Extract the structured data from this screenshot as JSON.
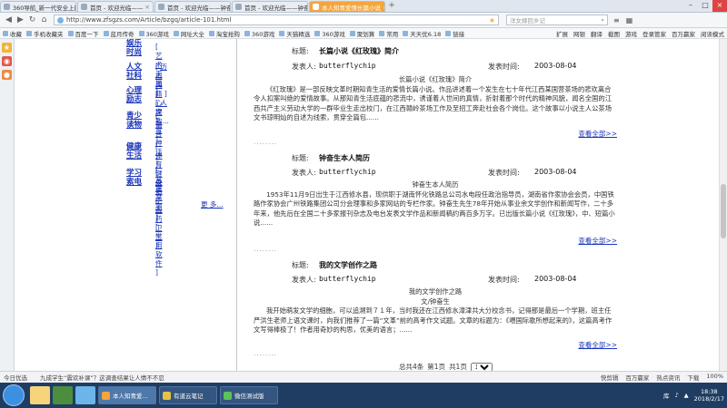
{
  "browser": {
    "tabs": [
      {
        "label": "360导航_新一代安全上网导航"
      },
      {
        "label": "首页 - 欢迎光临——"
      },
      {
        "label": "首页 - 欢迎光临——钟奋生工作"
      },
      {
        "label": "首页 - 欢迎光临——钟奋生工作"
      },
      {
        "label": "本人知青爱情长篇小说《红玫瑰》"
      }
    ],
    "url": "http://www.zfsgzs.com/Article/bzgq/article-101.html",
    "search_placeholder": "洋女嫁回乡记",
    "bookmarks": [
      "收藏",
      "手机收藏夹",
      "百度一下",
      "蓝月传奇",
      "360游戏",
      "网址大全",
      "淘宝抢购",
      "360游戏",
      "天猫精选",
      "360游戏",
      "聚划算",
      "常用",
      "天天优6.18",
      "链接"
    ],
    "bookmarks_right": [
      "扩展",
      "网银",
      "翻译",
      "截图",
      "游戏",
      "登录管家",
      "百万赢家",
      "阅读模式"
    ]
  },
  "nav": {
    "groups": [
      {
        "cat": "娱乐时尚",
        "subs": [
          "艺术天地"
        ]
      },
      {
        "cat": "人文社科",
        "subs": [
          "历史典籍",
          "人文"
        ]
      },
      {
        "cat": "心理励志",
        "subs": [
          "心理教育"
        ]
      },
      {
        "cat": "青少读物",
        "subs": [
          "寓言神话",
          "儿童文学"
        ]
      },
      {
        "cat": "健康生活",
        "subs": [
          "体育健身",
          "医药卫生"
        ]
      },
      {
        "cat": "学习索电",
        "subs": [
          "英语学习",
          "常用软件"
        ]
      }
    ],
    "more": "更 多..."
  },
  "articles": [
    {
      "title_label": "标题:",
      "title": "长篇小说《红玫瑰》简介",
      "author_label": "发表人:",
      "author": "butterflychip",
      "time_label": "发表时间:",
      "time": "2003-08-04",
      "heading": "长篇小说《红玫瑰》简介",
      "body": "《红玫瑰》是一部反映文革时期知青生活的爱情长篇小说。作品讲述着一个发生在七十年代江西某国营茶场的悲欢离合令人扣案叫绝的爱情故事。从那知青生活底蕴的悲流中，诱谨着人世间的真情，折射着那个时代的精神风貌，闻名全国的江西共产主义劳动大学的一群毕业生走出校门，在江西赣岭茶场工作及至招工奔赴社会各个岗位。这个故事以小说主人公茶场文书琼明灿的自述为线索，贯穿全篇包......",
      "view_all": "查看全部>>"
    },
    {
      "title_label": "标题:",
      "title": "钟奋生本人简历",
      "author_label": "发表人:",
      "author": "butterflychip",
      "time_label": "发表时间:",
      "time": "2003-08-04",
      "heading": "钟奋生本人简历",
      "body": "1953年11月9日出生于江西修水县，现供职于湖南怀化铁路总公司水电段任政治指导员，湖南省作家协会会员，中国铁路作家协会广州铁路集团公司分会理事和多家网站的专栏作家。钟奋生先生78年开始从事业余文学创作和新闻写作，二十多年来，他先后在全国二十多家报刊杂志及电台发表文学作品和新闻稿约两百多万字。已出版长篇小说《红玫瑰》，中、短篇小说......",
      "view_all": "查看全部>>"
    },
    {
      "title_label": "标题:",
      "title": "我的文学创作之路",
      "author_label": "发表人:",
      "author": "butterflychip",
      "time_label": "发表时间:",
      "time": "2003-08-04",
      "heading": "我的文学创作之路",
      "byline": "文/钟奋生",
      "body": "我开始萌发文学的细胞，可以追溯到７１年，当时我还在江西修水漳津共大分校念书，记得那是最后一个学期，班主任严洪生老师上语文课时，向我们推荐了一篇“文革”前的高考作文试题。文章的标题为：《喂国际歌所想起来的》，这篇高考作文写得棒极了！作者用奇妙的构思，优美的语言；......",
      "view_all": "查看全部>>"
    }
  ],
  "pager": {
    "total": "总共4条",
    "page": "第1页",
    "count": "共1页",
    "select": "1"
  },
  "statusbar": {
    "left": "今日优选",
    "news": "九成学生“震欢补课”？这调查结果让人情不不忍",
    "right": [
      "快剪辑",
      "百万赢家",
      "热点资讯",
      "下载",
      "100%"
    ]
  },
  "taskbar": {
    "tasks": [
      "本人知青爱...",
      "有道云笔记",
      "微信测试版"
    ],
    "tray_label": "库",
    "time": "18:38",
    "date": "2018/2/17"
  }
}
